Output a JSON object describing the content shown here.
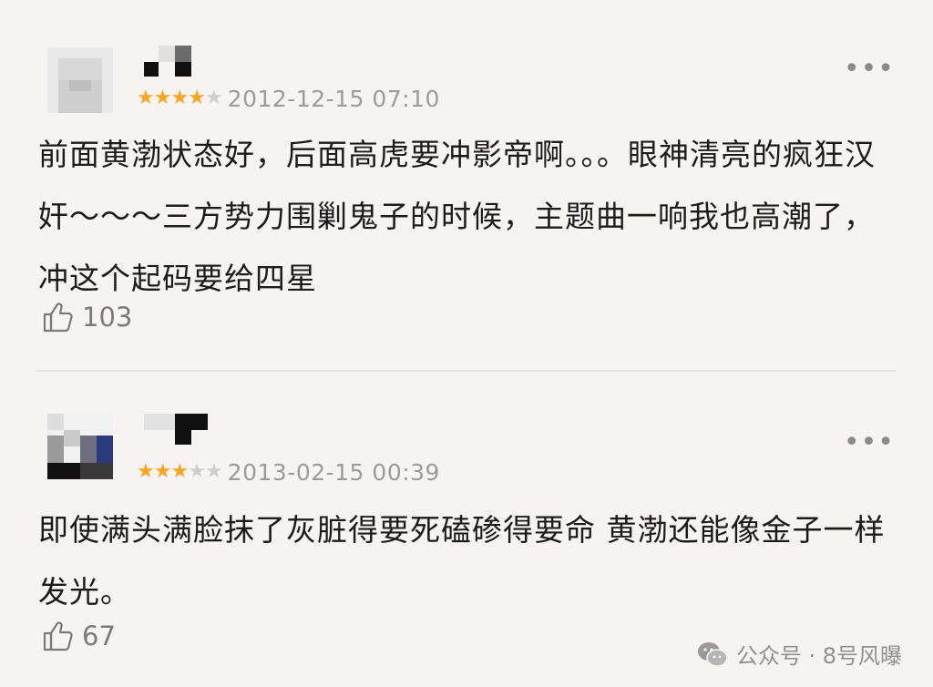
{
  "comments": [
    {
      "rating": 4,
      "max_rating": 5,
      "time": "2012-12-15 07:10",
      "text": "前面黄渤状态好，后面高虎要冲影帝啊。。。眼神清亮的疯狂汉奸～～～三方势力围剿鬼子的时候，主题曲一响我也高潮了，冲这个起码要给四星",
      "likes": "103"
    },
    {
      "rating": 3,
      "max_rating": 5,
      "time": "2013-02-15 00:39",
      "text": "即使满头满脸抹了灰脏得要死磕碜得要命  黄渤还能像金子一样发光。",
      "likes": "67"
    }
  ],
  "more_glyph": "•••",
  "watermark": {
    "text": "公众号 · 8号风曝",
    "icon": "wechat-icon"
  },
  "colors": {
    "star_on": "#f5a623",
    "star_off": "#cfcfcf",
    "background": "#f7f3f3"
  }
}
